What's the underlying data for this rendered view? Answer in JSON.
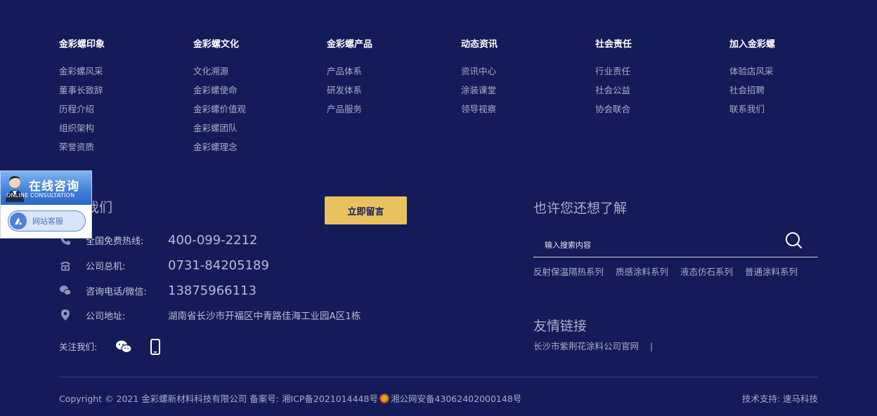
{
  "nav": [
    {
      "title": "金彩螺印象",
      "items": [
        "金彩螺风采",
        "董事长致辞",
        "历程介绍",
        "组织架构",
        "荣誉资质"
      ]
    },
    {
      "title": "金彩螺文化",
      "items": [
        "文化溯源",
        "金彩螺使命",
        "金彩螺价值观",
        "金彩螺团队",
        "金彩螺理念"
      ]
    },
    {
      "title": "金彩螺产品",
      "items": [
        "产品体系",
        "研发体系",
        "产品服务"
      ]
    },
    {
      "title": "动态资讯",
      "items": [
        "资讯中心",
        "涂装课堂",
        "领导视察"
      ]
    },
    {
      "title": "社会责任",
      "items": [
        "行业责任",
        "社会公益",
        "协会联合"
      ]
    },
    {
      "title": "加入金彩螺",
      "items": [
        "体验店风采",
        "社会招聘",
        "联系我们"
      ]
    }
  ],
  "contact": {
    "title": "联系我们",
    "leave_message": "立即留言",
    "rows": [
      {
        "icon": "phone-icon",
        "label": "全国免费热线:",
        "value": "400-099-2212"
      },
      {
        "icon": "telephone-icon",
        "label": "公司总机:",
        "value": "0731-84205189"
      },
      {
        "icon": "wechat-icon",
        "label": "咨询电话/微信:",
        "value": "13875966113"
      },
      {
        "icon": "location-icon",
        "label": "公司地址:",
        "value": "湖南省长沙市开福区中青路佳海工业园A区1栋"
      }
    ],
    "follow_label": "关注我们:"
  },
  "search": {
    "title": "也许您还想了解",
    "placeholder": "输入搜索内容",
    "tags": [
      "反射保温隔热系列",
      "质感涂料系列",
      "液态仿石系列",
      "普通涂料系列"
    ]
  },
  "links": {
    "title": "友情链接",
    "items": [
      "长沙市紫荆花涂料公司官网"
    ],
    "separator": "|"
  },
  "footer": {
    "copyright": "Copyright © 2021 金彩螺新材料科技有限公司 备案号: 湘ICP备2021014448号",
    "police": "湘公网安备43062402000148号",
    "tech_support": "技术支持: 速马科技"
  },
  "float_panel": {
    "title": "在线咨询",
    "subtitle": "ONLINE CONSULTATION",
    "service_label": "网站客服"
  },
  "colors": {
    "background": "#131b58",
    "accent": "#e8c25e",
    "text": "#a9adc9",
    "heading": "#ffffff"
  }
}
